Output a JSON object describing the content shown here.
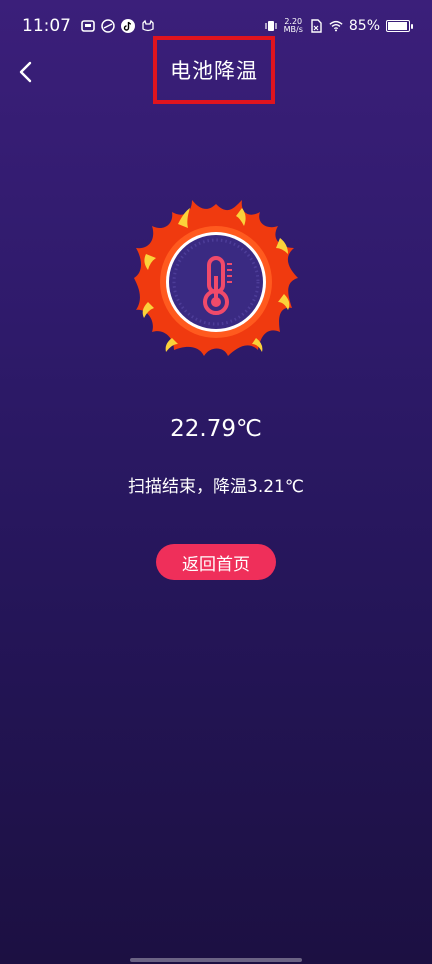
{
  "status_bar": {
    "time": "11:07",
    "net_speed_value": "2.20",
    "net_speed_unit": "MB/s",
    "battery_percent": "85%",
    "battery_level": 0.85
  },
  "header": {
    "title": "电池降温"
  },
  "main": {
    "temperature": "22.79℃",
    "scan_result": "扫描结束，降温3.21℃",
    "home_button_label": "返回首页"
  },
  "icons": {
    "back": "chevron-left-icon",
    "thermometer": "thermometer-icon",
    "flame": "flame-icon"
  },
  "colors": {
    "accent": "#ef2f5a",
    "highlight_border": "#e0141e",
    "flame_outer": "#f03a0f",
    "flame_inner": "#fbd23a",
    "dial_bg": "#3a2a82",
    "thermometer": "#f04a6a"
  }
}
